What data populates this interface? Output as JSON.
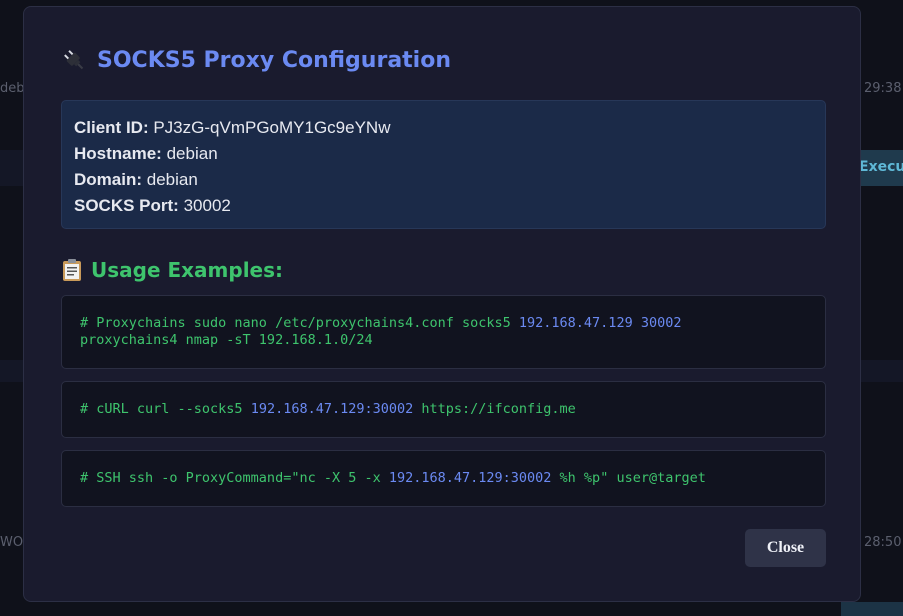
{
  "background": {
    "left_fragments": [
      "deb",
      "WO"
    ],
    "right_times": [
      "29:38",
      "28:50"
    ],
    "accent_text": "Execu"
  },
  "modal": {
    "title": "SOCKS5 Proxy Configuration",
    "title_icon": "plug-icon",
    "info": {
      "client_id_label": "Client ID:",
      "client_id": "PJ3zG-qVmPGoMY1Gc9eYNw",
      "hostname_label": "Hostname:",
      "hostname": "debian",
      "domain_label": "Domain:",
      "domain": "debian",
      "port_label": "SOCKS Port:",
      "port": "30002"
    },
    "usage_title": "Usage Examples:",
    "usage_icon": "clipboard-icon",
    "examples": [
      {
        "line1_pre": "# Proxychains sudo nano /etc/proxychains4.conf socks5 ",
        "line1_ip": "192.168.47.129 30002",
        "line2": "proxychains4 nmap -sT 192.168.1.0/24"
      },
      {
        "pre": "# cURL curl --socks5 ",
        "ip": "192.168.47.129:30002",
        "post": " https://ifconfig.me"
      },
      {
        "pre": "# SSH ssh -o ProxyCommand=\"nc -X 5 -x ",
        "ip": "192.168.47.129:30002",
        "post": " %h %p\" user@target"
      }
    ],
    "close_label": "Close"
  },
  "colors": {
    "accent_blue": "#6b8af2",
    "accent_green": "#3ec46d",
    "modal_bg": "#1a1b2e",
    "info_bg": "#1b2a48"
  }
}
